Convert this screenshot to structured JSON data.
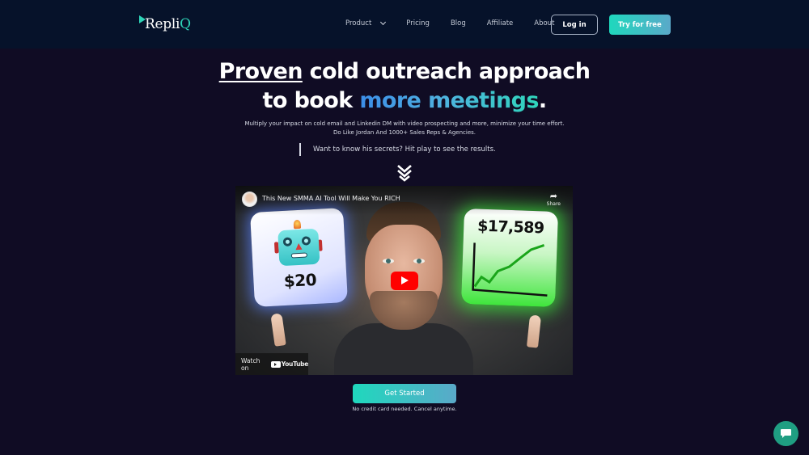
{
  "brand": {
    "name_main": "Repli",
    "name_accent": "Q"
  },
  "nav": {
    "items": [
      {
        "label": "Product",
        "has_dropdown": true
      },
      {
        "label": "Pricing"
      },
      {
        "label": "Blog"
      },
      {
        "label": "Affiliate"
      },
      {
        "label": "About"
      }
    ],
    "login_label": "Log in",
    "try_label": "Try for free"
  },
  "hero": {
    "headline_underlined": "Proven",
    "headline_rest_line1": " cold outreach approach",
    "headline_line2_plain": "to book ",
    "headline_line2_gradient": "more meetings",
    "headline_line2_end": ".",
    "subtitle_line1": "Multiply your impact on cold email and Linkedin DM with video prospecting and more,  minimize your time effort.",
    "subtitle_line2": "Do Like Jordan And 1000+ Sales Reps & Agencies.",
    "secret_text": "Want to know his secrets? Hit play to see the results."
  },
  "video": {
    "title": "This New SMMA AI Tool Will Make You RICH",
    "share_label": "Share",
    "left_card_price": "$20",
    "right_card_price": "$17,589",
    "watch_on_label": "Watch on",
    "youtube_label": "YouTube"
  },
  "cta": {
    "label": "Get Started",
    "note": "No credit card needed. Cancel anytime."
  },
  "colors": {
    "accent_teal": "#1fd8bd",
    "accent_blue": "#5aa9c9",
    "background": "#100c24",
    "navbar": "#06122a",
    "chat": "#1f9e82"
  }
}
